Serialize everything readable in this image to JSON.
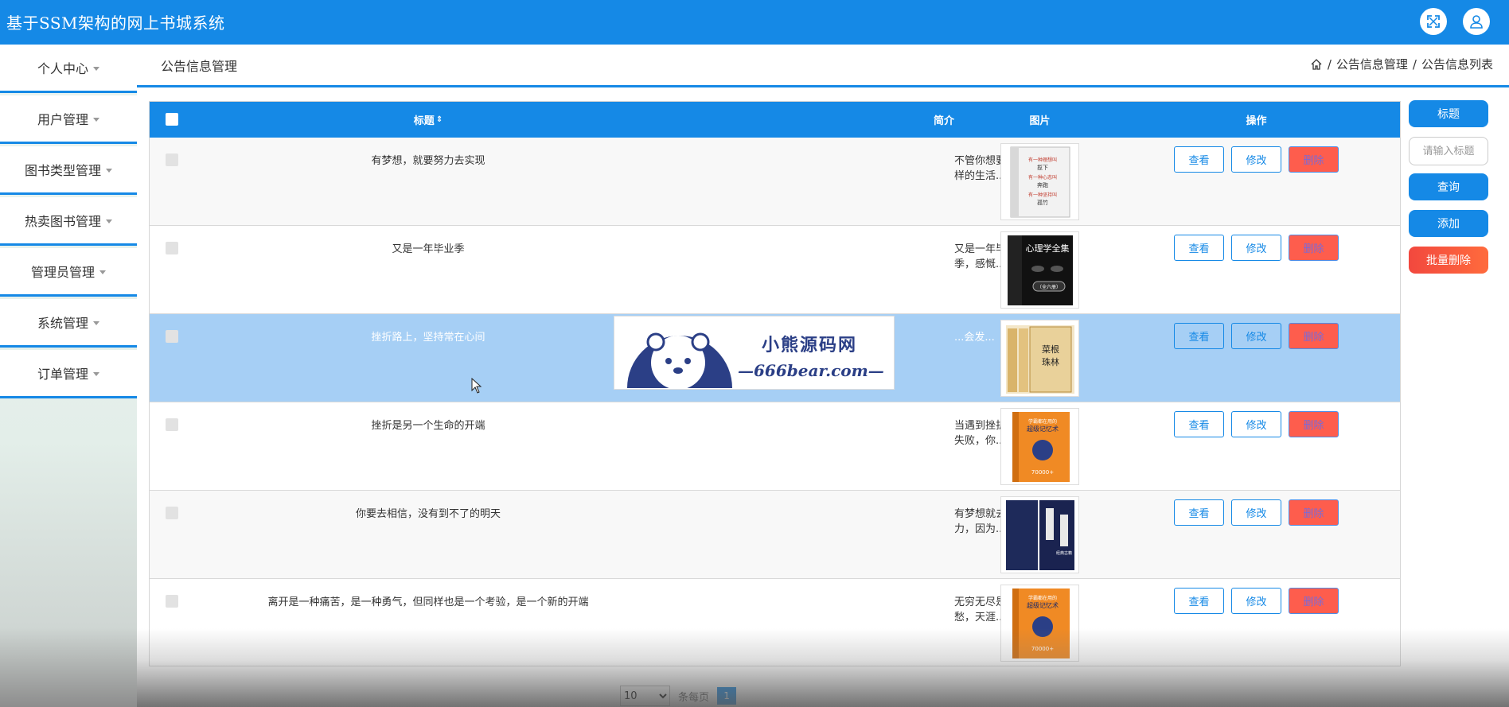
{
  "header": {
    "app_title": "基于SSM架构的网上书城系统",
    "fullscreen_icon": "fullscreen-icon",
    "user_icon": "user-icon"
  },
  "sidebar": {
    "items": [
      {
        "label": "个人中心"
      },
      {
        "label": "用户管理"
      },
      {
        "label": "图书类型管理"
      },
      {
        "label": "热卖图书管理"
      },
      {
        "label": "管理员管理"
      },
      {
        "label": "系统管理"
      },
      {
        "label": "订单管理"
      }
    ]
  },
  "content_header": {
    "page_title": "公告信息管理",
    "breadcrumb": [
      "公告信息管理",
      "公告信息列表"
    ],
    "separator": "/"
  },
  "table": {
    "columns": {
      "title": "标题",
      "brief": "简介",
      "image": "图片",
      "actions": "操作"
    },
    "rows": [
      {
        "title": "有梦想，就要努力去实现",
        "brief": "不管你想要怎样的生活..."
      },
      {
        "title": "又是一年毕业季",
        "brief": "又是一年毕业季，感慨..."
      },
      {
        "title": "挫折路上，坚持常在心间",
        "brief": "...会发..."
      },
      {
        "title": "挫折是另一个生命的开端",
        "brief": "当遇到挫折或失败，你..."
      },
      {
        "title": "你要去相信，没有到不了的明天",
        "brief": "有梦想就去努力，因为..."
      },
      {
        "title": "离开是一种痛苦，是一种勇气，但同样也是一个考验，是一个新的开端",
        "brief": "无穷无尽是离愁，天涯..."
      }
    ],
    "actions": {
      "view": "查看",
      "edit": "修改",
      "delete": "删除"
    }
  },
  "right_panel": {
    "title_label": "标题",
    "search_placeholder": "请输入标题",
    "search_label": "查询",
    "add_label": "添加",
    "batch_delete_label": "批量删除"
  },
  "pagination": {
    "page_size": "10",
    "per_page_label": "条每页",
    "current_page": "1"
  },
  "watermark": {
    "line1": "小熊源码网",
    "line2": "—666bear.com—"
  },
  "colors": {
    "primary": "#1589e6",
    "danger": "#fe5d4d",
    "selected_row": "#a6cff5"
  },
  "cover_books": [
    {
      "lines": [
        "有一种理想叫",
        "揽下",
        "有一种心态叫",
        "奔跑",
        "有一种坚持叫",
        "孤竹"
      ]
    },
    {
      "lines": [
        "心理学全集",
        "（全六册）"
      ]
    },
    {
      "lines": [
        "菜根",
        "珠林"
      ]
    },
    {
      "lines": [
        "学霸都在用的",
        "超级记忆术",
        "70000+"
      ]
    },
    {
      "lines": [
        "经典古籍"
      ]
    },
    {
      "lines": [
        "学霸都在用的",
        "超级记忆术",
        "70000+"
      ]
    }
  ]
}
